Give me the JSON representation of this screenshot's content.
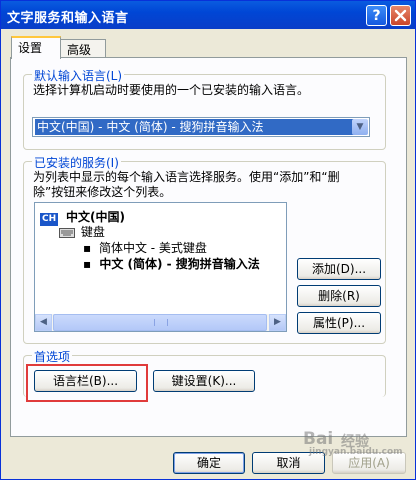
{
  "window": {
    "title": "文字服务和输入语言",
    "help_label": "?",
    "close_label": "X"
  },
  "tabs": [
    {
      "label": "设置"
    },
    {
      "label": "高级"
    }
  ],
  "default_language": {
    "group_label": "默认输入语言(L)",
    "description": "选择计算机启动时要使用的一个已安装的输入语言。",
    "selected": "中文(中国) - 中文 (简体) - 搜狗拼音输入法"
  },
  "installed_services": {
    "group_label": "已安装的服务(I)",
    "description_line1": "为列表中显示的每个输入语言选择服务。使用“添加”和“删",
    "description_line2": "除”按钮来修改这个列表。",
    "tree": {
      "language_badge": "CH",
      "language": "中文(中国)",
      "category": "键盘",
      "items": [
        "简体中文 - 美式键盘",
        "中文 (简体) - 搜狗拼音输入法"
      ]
    },
    "buttons": {
      "add": "添加(D)...",
      "remove": "删除(R)",
      "properties": "属性(P)..."
    }
  },
  "preferences": {
    "group_label": "首选项",
    "language_bar": "语言栏(B)...",
    "key_settings": "键设置(K)..."
  },
  "footer": {
    "ok": "确定",
    "cancel": "取消",
    "apply": "应用(A)"
  },
  "watermark": {
    "line1": "Bai",
    "line2": "经验",
    "line3": "jingyan.baidu.com"
  }
}
